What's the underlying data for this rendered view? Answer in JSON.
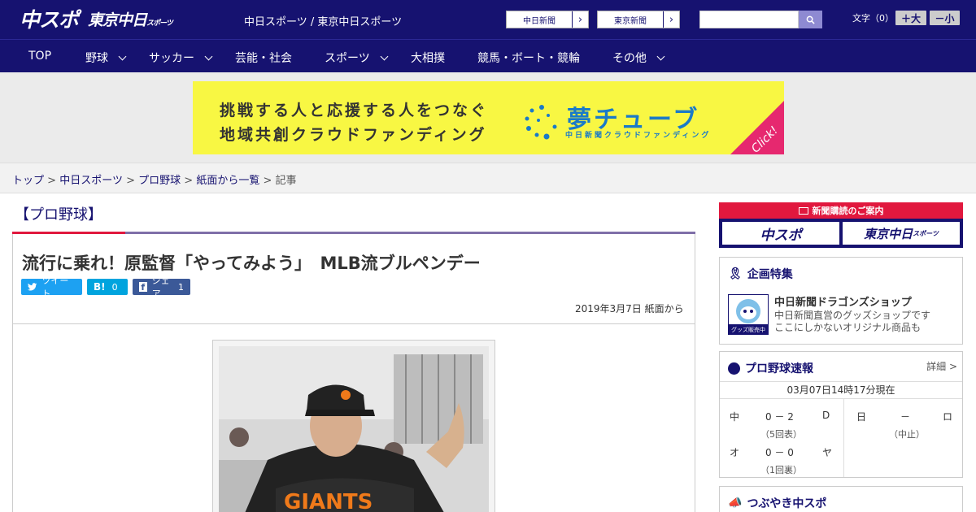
{
  "header": {
    "logo_main": "中スポ",
    "logo_sub": "東京中日",
    "logo_sub_small": "スポーツ",
    "site_desc": "中日スポーツ / 東京中日スポーツ",
    "paper_links": [
      "中日新聞",
      "東京新聞"
    ],
    "font_size_label": "文字（0）",
    "font_larger": "＋大",
    "font_smaller": "－小"
  },
  "nav": {
    "items": [
      {
        "label": "TOP"
      },
      {
        "label": "野球"
      },
      {
        "label": "サッカー"
      },
      {
        "label": "芸能・社会"
      },
      {
        "label": "スポーツ"
      },
      {
        "label": "大相撲"
      },
      {
        "label": "競馬・ボート・競輪"
      },
      {
        "label": "その他"
      }
    ]
  },
  "banner": {
    "line1": "挑戦する人と応援する人をつなぐ",
    "line2": "地域共創クラウドファンディング",
    "brand": "夢チューブ",
    "brand_sub": "中日新聞クラウドファンディング",
    "click": "Click!",
    "background_color": "#f8f743",
    "accent_color": "#1a7ac8",
    "corner_color": "#e6286f"
  },
  "breadcrumb": {
    "items": [
      "トップ",
      "中日スポーツ",
      "プロ野球",
      "紙面から一覧"
    ],
    "current": "記事",
    "separator": ">"
  },
  "article": {
    "category": "【プロ野球】",
    "title": "流行に乗れ！原監督「やってみよう」　MLB流ブルペンデー",
    "tweet_label": "ツイート",
    "hatena_label": "B!",
    "hatena_count": "0",
    "share_label": "シェア",
    "share_count": "1",
    "date": "2019年3月7日 紙面から",
    "photo_desc_icon": "baseball-manager-photo"
  },
  "sidebar": {
    "subscription_head": "新聞購読のご案内",
    "sub_chuspo": "中スポ",
    "sub_tokyo": "東京中日",
    "sub_tokyo_small": "スポーツ",
    "feature_title": "企画特集",
    "shop_name": "中日新聞ドラゴンズショップ",
    "shop_desc_1": "中日新聞直営のグッズショップです",
    "shop_desc_2": "ここにしかないオリジナル商品も",
    "shop_badge": "グッズ販売中",
    "score_title": "プロ野球速報",
    "score_detail": "詳細 >",
    "score_time": "03月07日14時17分現在",
    "games": [
      {
        "home": "中",
        "score": "0 － 2",
        "away": "D",
        "status": "（5回表）"
      },
      {
        "home": "日",
        "score": "－",
        "away": "ロ",
        "status": "（中止）"
      },
      {
        "home": "オ",
        "score": "0 － 0",
        "away": "ヤ",
        "status": "（1回裏）"
      }
    ],
    "tsubuyaki_title": "つぶやき中スポ"
  },
  "colors": {
    "brand_navy": "#161270",
    "brand_red": "#e1183e",
    "twitter": "#1da1f2",
    "hatena": "#00a4de",
    "facebook": "#3b5998"
  }
}
